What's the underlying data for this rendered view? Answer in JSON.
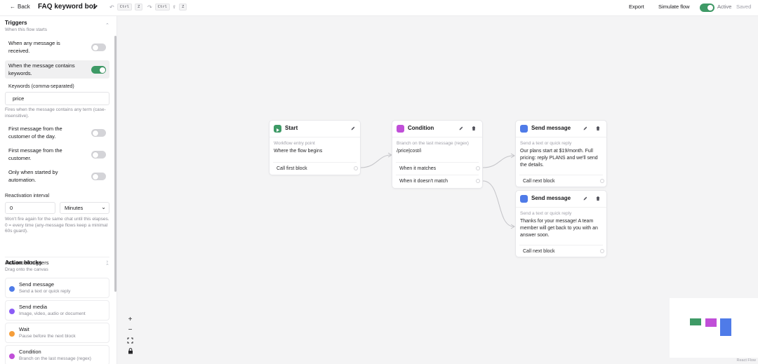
{
  "topbar": {
    "back_label": "Back",
    "title": "FAQ keyword bot",
    "undo_key1": "Ctrl",
    "undo_key2": "Z",
    "redo_key1": "Ctrl",
    "redo_key2": "⇧",
    "redo_key3": "Z",
    "export_label": "Export",
    "simulate_label": "Simulate flow",
    "active_label": "Active",
    "saved_label": "Saved",
    "active": true
  },
  "triggers": {
    "title": "Triggers",
    "subtitle": "When this flow starts",
    "items": [
      {
        "label": "When any message is received.",
        "on": false
      },
      {
        "label": "When the message contains keywords.",
        "on": true
      },
      {
        "label": "First message from the customer of the day.",
        "on": false
      },
      {
        "label": "First message from the customer.",
        "on": false
      },
      {
        "label": "Only when started by automation.",
        "on": false
      }
    ],
    "keywords_label": "Keywords (comma-separated)",
    "keywords_value": "price",
    "keywords_help": "Fires when the message contains any term (case-insensitive).",
    "reactivation_label": "Reactivation interval",
    "reactivation_value": "0",
    "reactivation_unit": "Minutes",
    "reactivation_help": "Won't fire again for the same chat until this elapses. 0 = every time (any-message flows keep a minimal 60s guard).",
    "advanced_label": "Advanced triggers"
  },
  "actions": {
    "title": "Action blocks",
    "subtitle": "Drag onto the canvas",
    "items": [
      {
        "title": "Send message",
        "sub": "Send a text or quick reply",
        "color": "#4f7be8"
      },
      {
        "title": "Send media",
        "sub": "Image, video, audio or document",
        "color": "#8b5cf6"
      },
      {
        "title": "Wait",
        "sub": "Pause before the next block",
        "color": "#f59e3a"
      },
      {
        "title": "Condition",
        "sub": "Branch on the last message (regex)",
        "color": "#c04fd8"
      }
    ]
  },
  "nodes": {
    "start": {
      "title": "Start",
      "sub": "Workflow entry point",
      "body": "Where the flow begins",
      "port": "Call first block",
      "color": "#3e9a66"
    },
    "condition": {
      "title": "Condition",
      "sub": "Branch on the last message (regex)",
      "body": "/price|cost/i",
      "port_match": "When it matches",
      "port_nomatch": "When it doesn't match",
      "color": "#c04fd8"
    },
    "send1": {
      "title": "Send message",
      "sub": "Send a text or quick reply",
      "body": "Our plans start at $19/month. Full pricing: reply PLANS and we'll send the details.",
      "port": "Call next block",
      "color": "#4f7be8"
    },
    "send2": {
      "title": "Send message",
      "sub": "Send a text or quick reply",
      "body": "Thanks for your message! A team member will get back to you with an answer soon.",
      "port": "Call next block",
      "color": "#4f7be8"
    }
  },
  "canvas": {
    "zoom_in": "+",
    "zoom_out": "−",
    "attribution": "React Flow"
  },
  "minimap": {
    "colors": [
      "#3e9a66",
      "#c04fd8",
      "#4f7be8"
    ]
  }
}
